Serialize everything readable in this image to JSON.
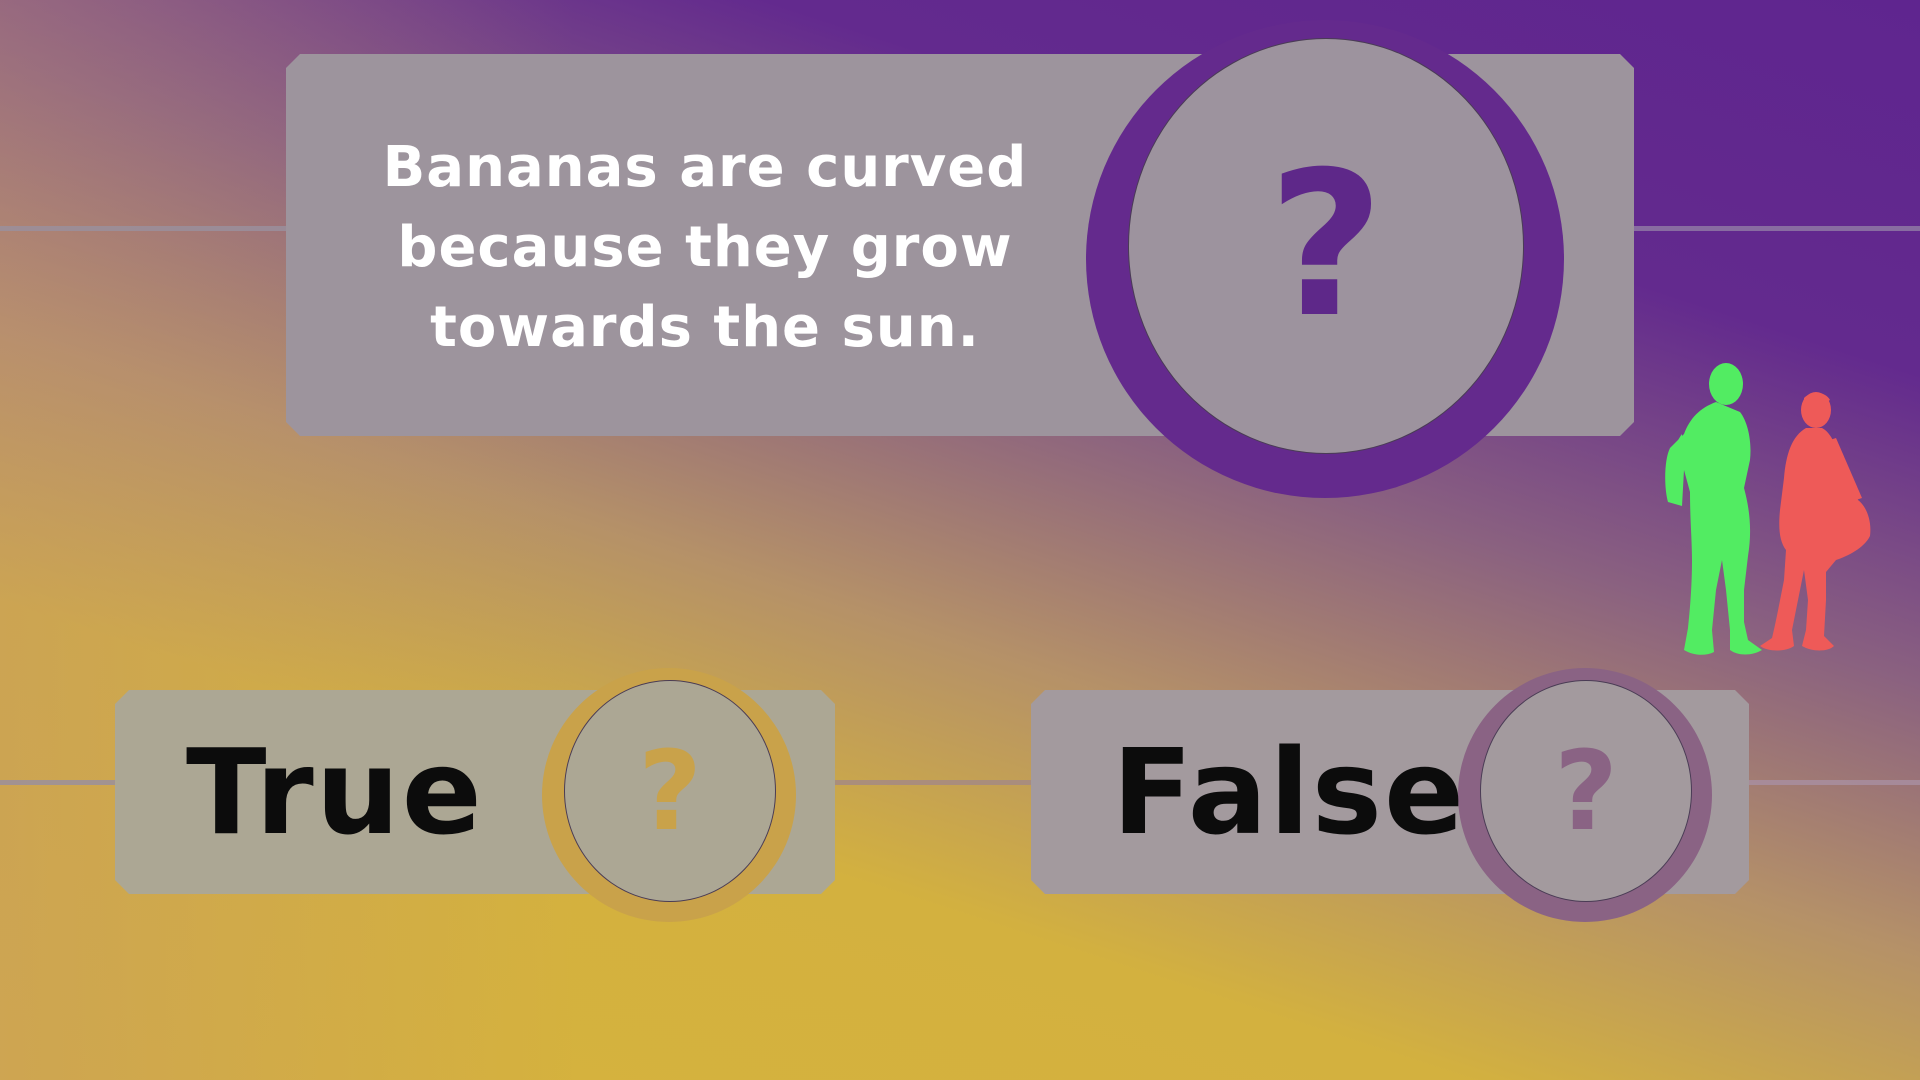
{
  "question": {
    "text": "Bananas are curved because they grow towards the sun.",
    "icon": "question-mark",
    "icon_glyph": "?"
  },
  "answers": [
    {
      "label": "True",
      "icon": "question-mark",
      "icon_glyph": "?",
      "color": "#c9a24a"
    },
    {
      "label": "False",
      "icon": "question-mark",
      "icon_glyph": "?",
      "color": "#8a6384"
    }
  ],
  "decoration": {
    "people": [
      "green-person-silhouette",
      "red-person-silhouette"
    ],
    "colors": {
      "green": "#52ec62",
      "red": "#ee5a58",
      "accent": "#642a8d"
    }
  }
}
